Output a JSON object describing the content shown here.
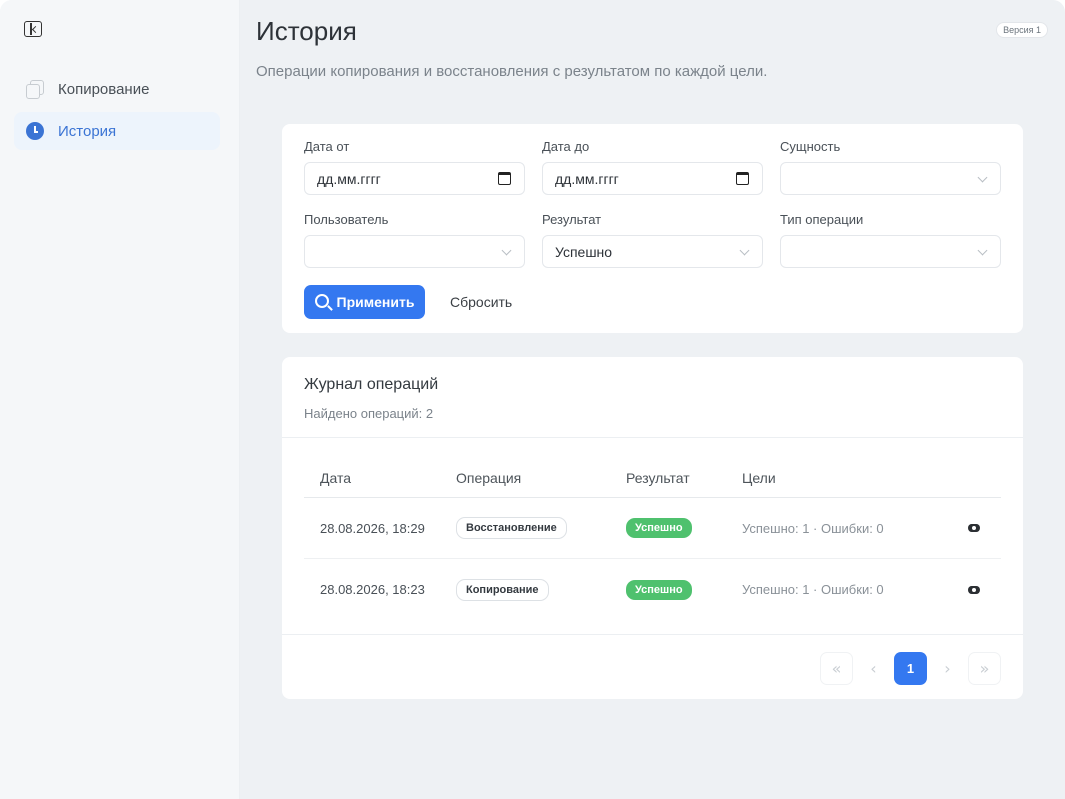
{
  "sidebar": {
    "items": [
      {
        "label": "Копирование",
        "icon": "copy-icon",
        "active": false
      },
      {
        "label": "История",
        "icon": "clock-icon",
        "active": true
      }
    ]
  },
  "header": {
    "title": "История",
    "subtitle": "Операции копирования и восстановления с результатом по каждой цели.",
    "version": "Версия 1"
  },
  "filters": {
    "date_from": {
      "label": "Дата от",
      "value": "дд.мм.гггг"
    },
    "date_to": {
      "label": "Дата до",
      "value": "дд.мм.гггг"
    },
    "entity": {
      "label": "Сущность",
      "value": ""
    },
    "user": {
      "label": "Пользователь",
      "value": ""
    },
    "result": {
      "label": "Результат",
      "value": "Успешно"
    },
    "op_type": {
      "label": "Тип операции",
      "value": ""
    },
    "apply_label": "Применить",
    "reset_label": "Сбросить"
  },
  "log": {
    "title": "Журнал операций",
    "count_text": "Найдено операций: 2",
    "columns": {
      "date": "Дата",
      "operation": "Операция",
      "result": "Результат",
      "targets": "Цели"
    },
    "rows": [
      {
        "date": "28.08.2026, 18:29",
        "operation": "Восстановление",
        "result": "Успешно",
        "targets": "Успешно: 1 · Ошибки: 0"
      },
      {
        "date": "28.08.2026, 18:23",
        "operation": "Копирование",
        "result": "Успешно",
        "targets": "Успешно: 1 · Ошибки: 0"
      }
    ]
  },
  "pagination": {
    "current": "1",
    "first": "«",
    "prev": "‹",
    "next": "›",
    "last": "»"
  },
  "colors": {
    "accent": "#3478f0",
    "success": "#4fc16e",
    "active_nav_bg": "#edf4fc"
  }
}
